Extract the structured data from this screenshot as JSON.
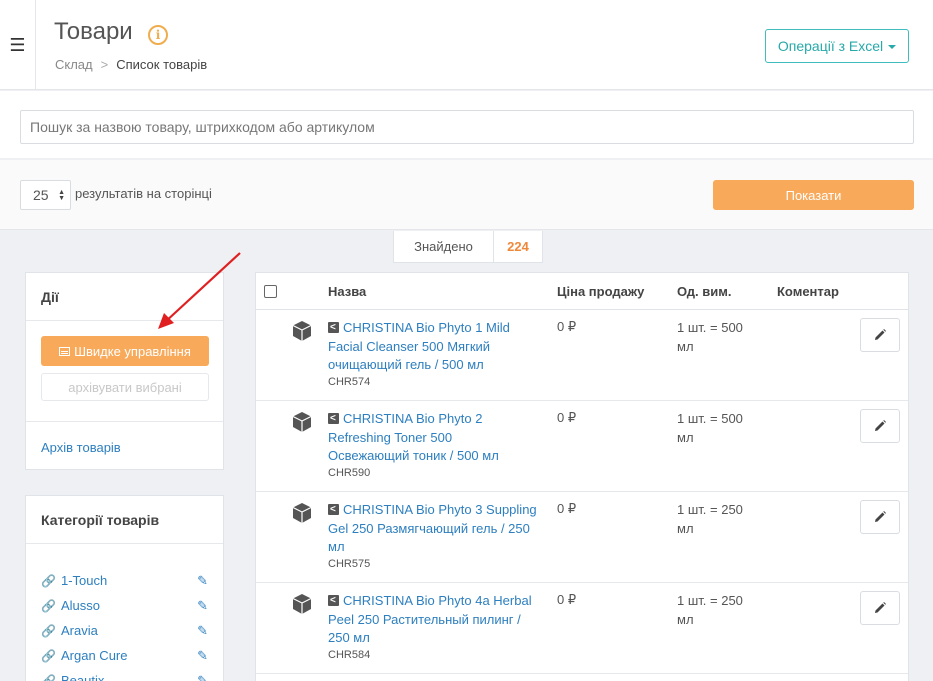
{
  "header": {
    "title": "Товари",
    "breadcrumb": {
      "root": "Склад",
      "separator": ">",
      "current": "Список товарів"
    },
    "excel_button": "Операції з Excel"
  },
  "search": {
    "placeholder": "Пошук за назвою товару, штрихкодом або артикулом"
  },
  "pager": {
    "per_page": "25",
    "per_page_label": "результатів на сторінці",
    "show_button": "Показати"
  },
  "found": {
    "label": "Знайдено",
    "count": "224"
  },
  "actions_panel": {
    "title": "Дії",
    "quick_manage": "Швидке управління",
    "archive_selected": "архівувати вибрані",
    "archive_link": "Архів товарів"
  },
  "categories_panel": {
    "title": "Категорії товарів",
    "items": [
      "1-Touch",
      "Alusso",
      "Aravia",
      "Argan Cure",
      "Beautix"
    ]
  },
  "table": {
    "columns": [
      "Назва",
      "Ціна продажу",
      "Од. вим.",
      "Коментар"
    ],
    "rows": [
      {
        "name_lines": [
          "CHRISTINA Bio Phyto 1 Mild",
          "Facial Cleanser 500 Мягкий",
          "очищающий гель / 500 мл"
        ],
        "sku": "CHR574",
        "price": "0 ₽",
        "unit_lines": [
          "1 шт. = 500",
          "мл"
        ]
      },
      {
        "name_lines": [
          "CHRISTINA Bio Phyto 2",
          "Refreshing Toner 500",
          "Освежающий тоник / 500 мл"
        ],
        "sku": "CHR590",
        "price": "0 ₽",
        "unit_lines": [
          "1 шт. = 500",
          "мл"
        ]
      },
      {
        "name_lines": [
          "CHRISTINA Bio Phyto 3 Suppling",
          "Gel 250 Размягчающий гель / 250",
          "мл"
        ],
        "sku": "CHR575",
        "price": "0 ₽",
        "unit_lines": [
          "1 шт. = 250",
          "мл"
        ]
      },
      {
        "name_lines": [
          "CHRISTINA Bio Phyto 4a Herbal",
          "Peel 250 Растительный пилинг /",
          "250 мл"
        ],
        "sku": "CHR584",
        "price": "0 ₽",
        "unit_lines": [
          "1 шт. = 250",
          "мл"
        ]
      }
    ]
  },
  "colors": {
    "accent_orange": "#f8a95a",
    "link_blue": "#2d7fbf",
    "teal": "#27a9a9",
    "annotation_red": "#e02020"
  }
}
